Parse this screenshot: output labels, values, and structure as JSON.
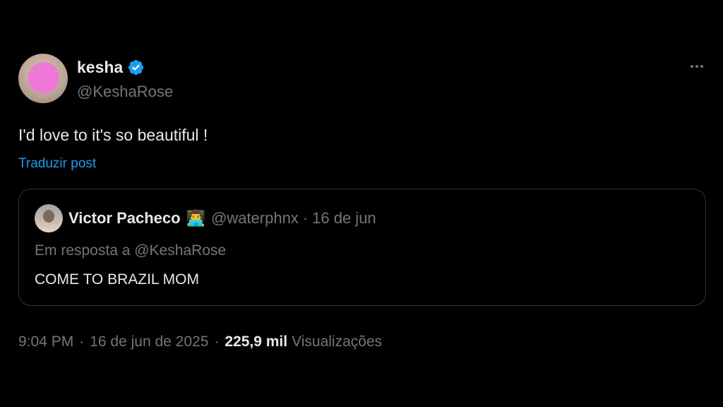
{
  "tweet": {
    "display_name": "kesha",
    "handle": "@KeshaRose",
    "text": "I'd love to it's so beautiful !",
    "translate_label": "Traduzir post",
    "time": "9:04 PM",
    "separator": "·",
    "date": "16 de jun de 2025",
    "views_count": "225,9 mil",
    "views_label": "Visualizações",
    "verified_icon": "verified-badge-icon",
    "more_icon": "more-options-icon"
  },
  "quoted": {
    "display_name": "Victor Pacheco",
    "emoji": "👨‍💻",
    "handle": "@waterphnx",
    "separator": "·",
    "date": "16 de jun",
    "reply_to": "Em resposta a @KeshaRose",
    "text": "COME TO BRAZIL MOM"
  },
  "colors": {
    "background": "#000000",
    "primary_text": "#e7e9ea",
    "secondary_text": "#71767b",
    "link": "#1d9bf0",
    "border": "#2f3336"
  }
}
